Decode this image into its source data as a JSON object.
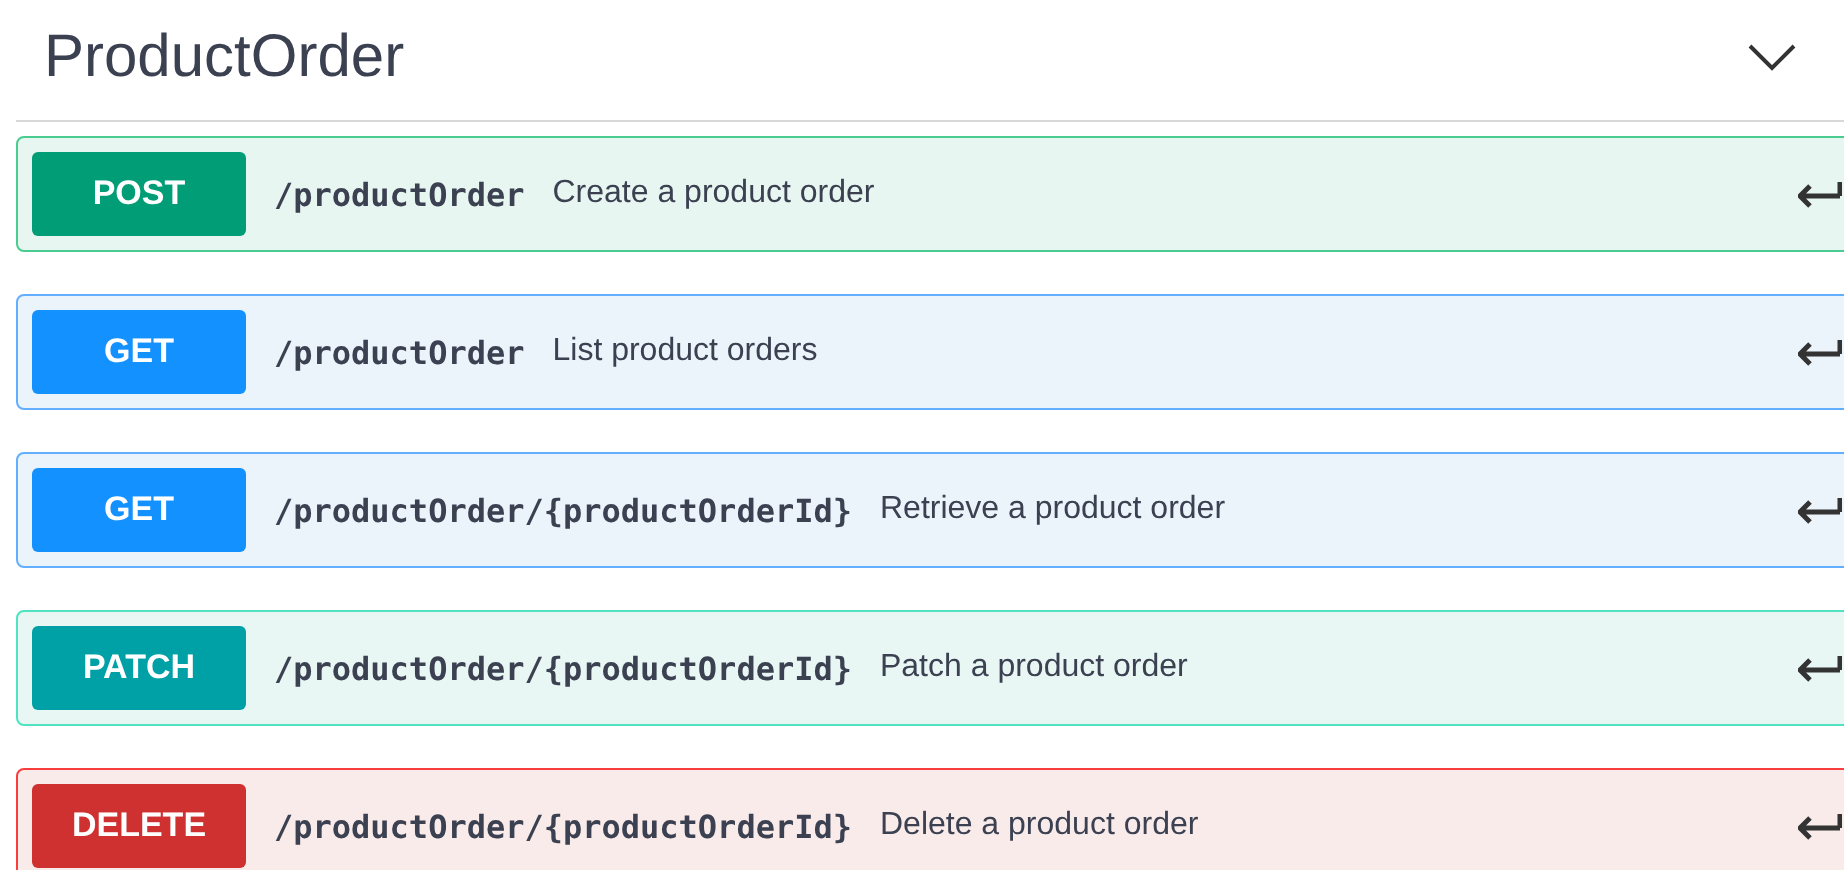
{
  "section": {
    "title": "ProductOrder",
    "expanded": true
  },
  "operations": [
    {
      "method": "POST",
      "path": "/productOrder",
      "summary": "Create a product order"
    },
    {
      "method": "GET",
      "path": "/productOrder",
      "summary": "List product orders"
    },
    {
      "method": "GET",
      "path": "/productOrder/{productOrderId}",
      "summary": "Retrieve a product order"
    },
    {
      "method": "PATCH",
      "path": "/productOrder/{productOrderId}",
      "summary": "Patch a product order"
    },
    {
      "method": "DELETE",
      "path": "/productOrder/{productOrderId}",
      "summary": "Delete a product order"
    }
  ]
}
